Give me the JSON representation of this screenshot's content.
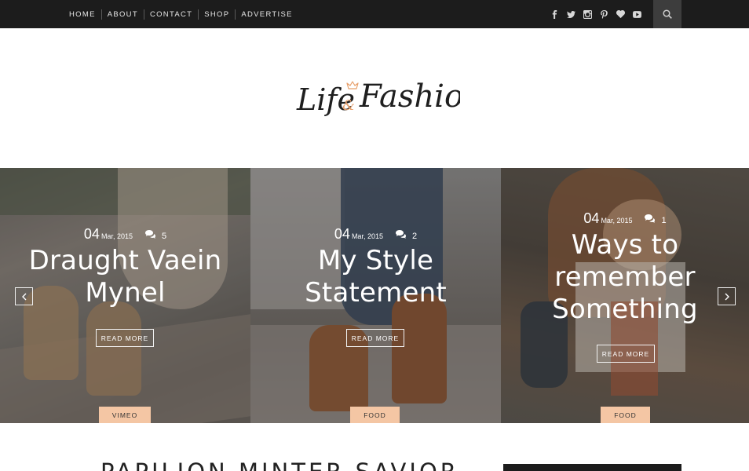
{
  "nav": {
    "items": [
      {
        "label": "HOME"
      },
      {
        "label": "ABOUT"
      },
      {
        "label": "CONTACT"
      },
      {
        "label": "SHOP"
      },
      {
        "label": "ADVERTISE"
      }
    ]
  },
  "social": {
    "icons": [
      "facebook-icon",
      "twitter-icon",
      "instagram-icon",
      "pinterest-icon",
      "heart-icon",
      "youtube-icon"
    ],
    "color": "#d8d8d8"
  },
  "search": {
    "icon": "search-icon"
  },
  "logo": {
    "word1": "Life",
    "ampersand": "&",
    "word2": "Fashion",
    "accent_color": "#e8a06b"
  },
  "slider": {
    "prev_icon": "chevron-left-icon",
    "next_icon": "chevron-right-icon",
    "slides": [
      {
        "day": "04",
        "month": "Mar, 2015",
        "comments": "5",
        "title_line1": "Draught Vaein",
        "title_line2": "Mynel",
        "title_line3": "",
        "read_more": "READ MORE",
        "category": "VIMEO"
      },
      {
        "day": "04",
        "month": "Mar, 2015",
        "comments": "2",
        "title_line1": "My Style",
        "title_line2": "Statement",
        "title_line3": "",
        "read_more": "READ MORE",
        "category": "FOOD"
      },
      {
        "day": "04",
        "month": "Mar, 2015",
        "comments": "1",
        "title_line1": "Ways to",
        "title_line2": "remember",
        "title_line3": "Something",
        "read_more": "READ MORE",
        "category": "FOOD"
      }
    ],
    "category_color": "#f4c6a4"
  },
  "post": {
    "heading": "PAPILION MINTER SAVIOR"
  }
}
